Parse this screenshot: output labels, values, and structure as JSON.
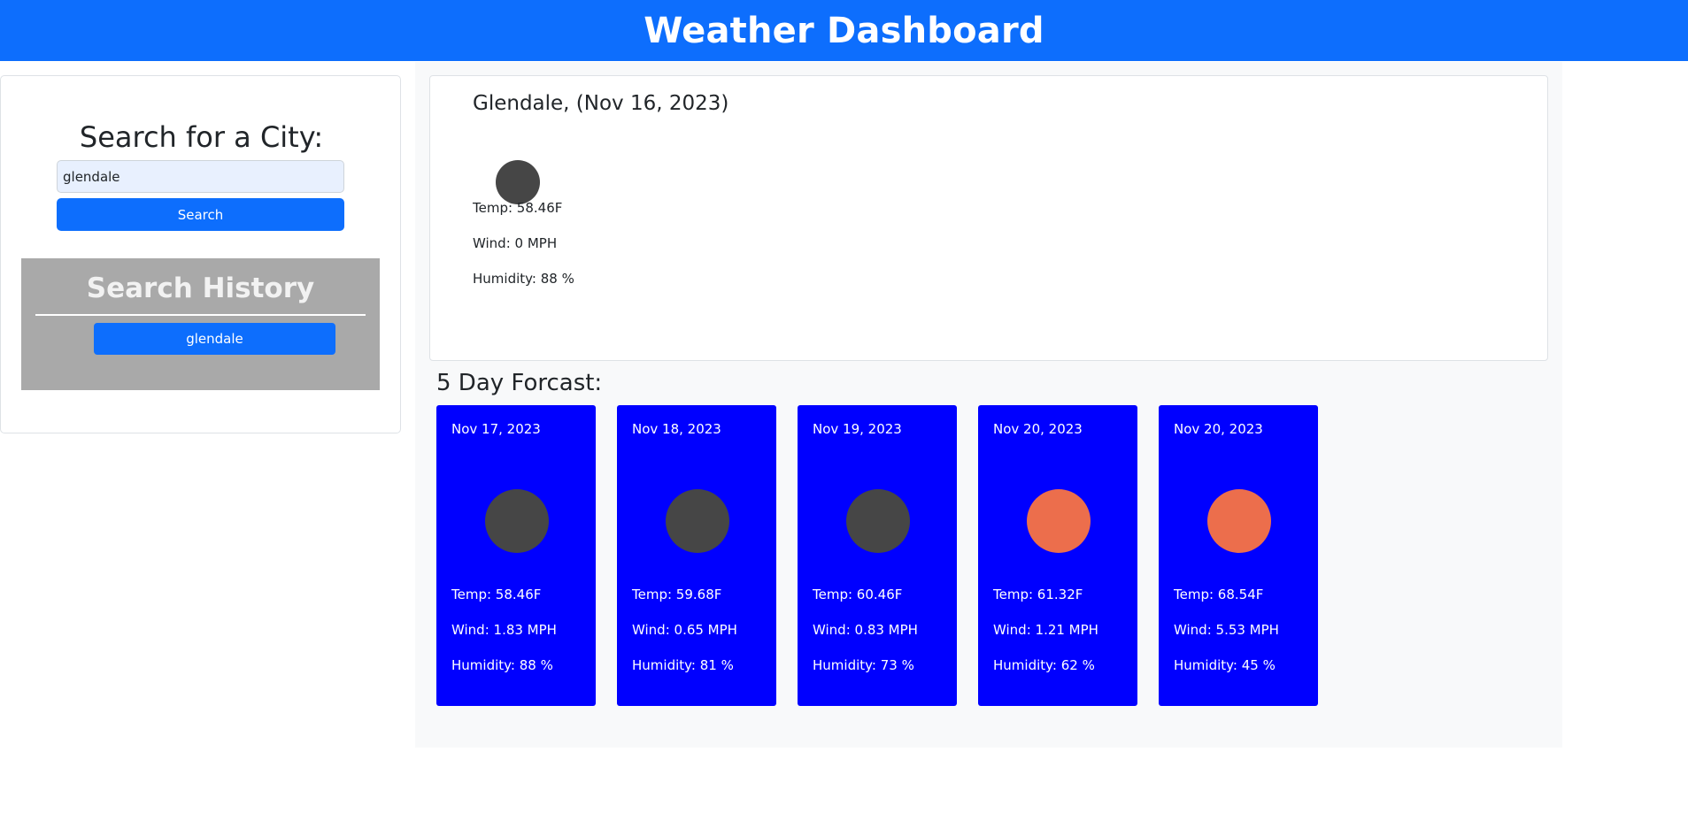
{
  "header": {
    "title": "Weather Dashboard"
  },
  "search": {
    "title": "Search for a City:",
    "input_value": "glendale",
    "button_label": "Search"
  },
  "history": {
    "title": "Search History",
    "items": [
      {
        "label": "glendale"
      }
    ]
  },
  "current": {
    "title": "Glendale, (Nov 16, 2023)",
    "icon": "dark-circle-weather-icon",
    "icon_color": "#464646",
    "temp": "Temp: 58.46F",
    "wind": "Wind: 0 MPH",
    "humidity": "Humidity: 88 %"
  },
  "forecast": {
    "heading": "5 Day Forcast:",
    "card_color": "#0000ff",
    "days": [
      {
        "date": "Nov 17, 2023",
        "icon": "dark-circle-weather-icon",
        "icon_color": "#464646",
        "temp": "Temp: 58.46F",
        "wind": "Wind: 1.83 MPH",
        "humidity": "Humidity: 88 %"
      },
      {
        "date": "Nov 18, 2023",
        "icon": "dark-circle-weather-icon",
        "icon_color": "#464646",
        "temp": "Temp: 59.68F",
        "wind": "Wind: 0.65 MPH",
        "humidity": "Humidity: 81 %"
      },
      {
        "date": "Nov 19, 2023",
        "icon": "dark-circle-weather-icon",
        "icon_color": "#464646",
        "temp": "Temp: 60.46F",
        "wind": "Wind: 0.83 MPH",
        "humidity": "Humidity: 73 %"
      },
      {
        "date": "Nov 20, 2023",
        "icon": "sun-weather-icon",
        "icon_color": "#ec6e4c",
        "temp": "Temp: 61.32F",
        "wind": "Wind: 1.21 MPH",
        "humidity": "Humidity: 62 %"
      },
      {
        "date": "Nov 20, 2023",
        "icon": "sun-weather-icon",
        "icon_color": "#ec6e4c",
        "temp": "Temp: 68.54F",
        "wind": "Wind: 5.53 MPH",
        "humidity": "Humidity: 45 %"
      }
    ]
  }
}
